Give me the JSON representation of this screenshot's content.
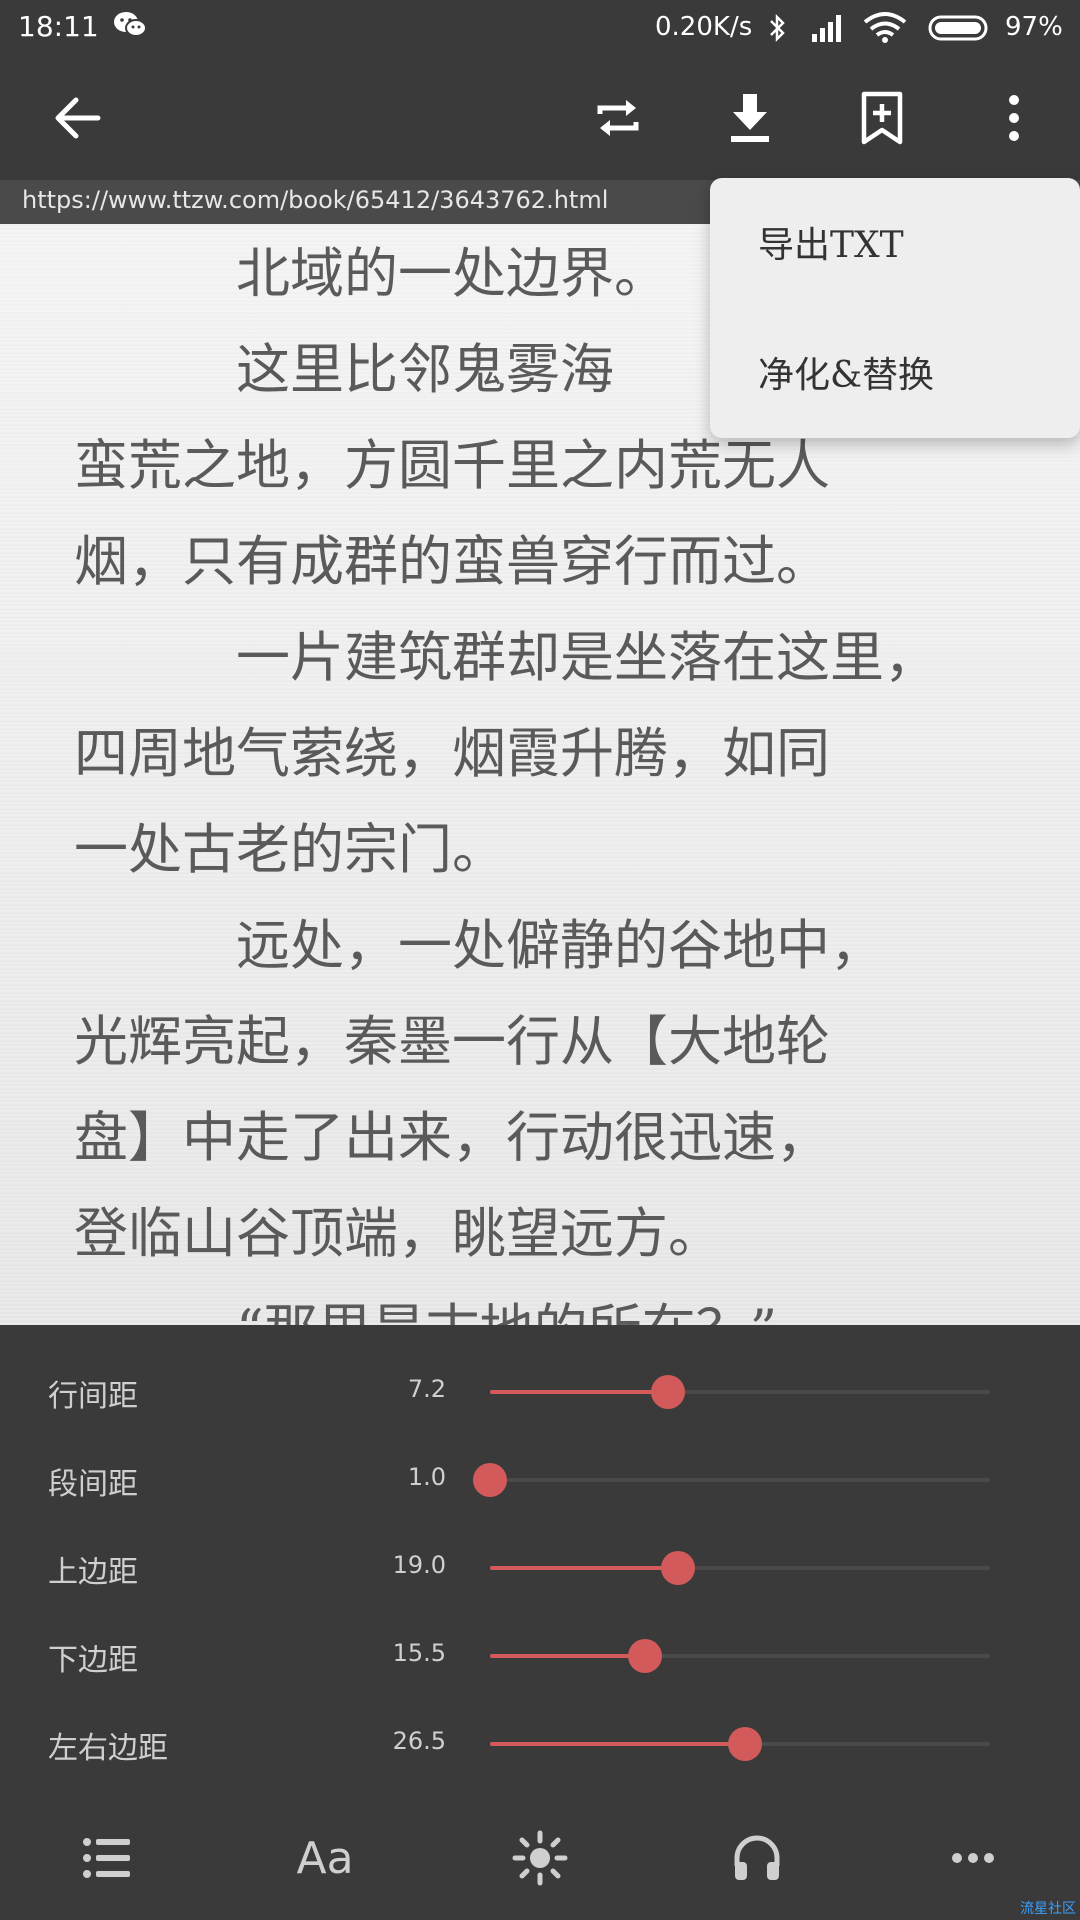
{
  "status_bar": {
    "time": "18:11",
    "network_speed": "0.20K/s",
    "battery": "97%"
  },
  "toolbar": {
    "icons": [
      "back-arrow-icon",
      "refresh-icon",
      "download-icon",
      "bookmark-add-icon",
      "more-vert-icon"
    ]
  },
  "url": "https://www.ttzw.com/book/65412/3643762.html",
  "reader": {
    "paragraphs": [
      "　　　北域的一处边界。",
      "　　　这里比邻鬼雾海",
      "蛮荒之地，方圆千里之内荒无人",
      "烟，只有成群的蛮兽穿行而过。",
      "　　　一片建筑群却是坐落在这里，",
      "四周地气萦绕，烟霞升腾，如同",
      "一处古老的宗门。",
      "　　　远处，一处僻静的谷地中，",
      "光辉亮起，秦墨一行从【大地轮",
      "盘】中走了出来，行动很迅速，",
      "登临山谷顶端，眺望远方。",
      "　　　“那里是古地的所在？”"
    ]
  },
  "overflow_menu": {
    "export_txt": "导出TXT",
    "purify_replace": "净化&替换"
  },
  "settings": {
    "rows": [
      {
        "label": "行间距",
        "value": "7.2",
        "fraction": 0.355
      },
      {
        "label": "段间距",
        "value": "1.0",
        "fraction": 0.0
      },
      {
        "label": "上边距",
        "value": "19.0",
        "fraction": 0.375
      },
      {
        "label": "下边距",
        "value": "15.5",
        "fraction": 0.31
      },
      {
        "label": "左右边距",
        "value": "26.5",
        "fraction": 0.51
      }
    ],
    "accent_color": "#d35a5a"
  },
  "bottom_nav": {
    "font_label": "Aa",
    "icons": [
      "list-icon",
      "font-icon",
      "brightness-icon",
      "headphones-icon",
      "more-horiz-icon"
    ]
  },
  "watermark": "流星社区"
}
